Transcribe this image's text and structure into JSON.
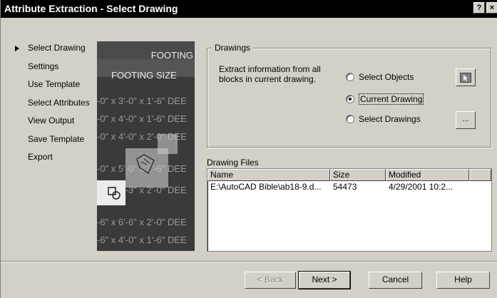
{
  "window": {
    "title": "Attribute Extraction - Select Drawing",
    "help_glyph": "?",
    "close_glyph": "×"
  },
  "steps": [
    {
      "label": "Select Drawing",
      "current": true
    },
    {
      "label": "Settings",
      "current": false
    },
    {
      "label": "Use Template",
      "current": false
    },
    {
      "label": "Select Attributes",
      "current": false
    },
    {
      "label": "View Output",
      "current": false
    },
    {
      "label": "Save Template",
      "current": false
    },
    {
      "label": "Export",
      "current": false
    }
  ],
  "illustration": {
    "header1": "FOOTING",
    "header2": "FOOTING SIZE",
    "rows": [
      "-0\" x 3'-0\" x 1'-6\" DEE",
      "-0\" x 4'-0\" x 1'-6\" DEE",
      "-0\" x 4'-0\" x 2'-0\" DEE",
      "-0\" x 5'-0\" x 1'-6\" DEE",
      "-0\" x 5'-3\" x 2'-0\" DEE",
      "-6\" x 6'-6\" x 2'-0\" DEE",
      "-6\" x 4'-0\" x 1'-6\" DEE"
    ]
  },
  "drawings_group": {
    "label": "Drawings",
    "description": "Extract information from all blocks in current drawing.",
    "options": [
      {
        "label": "Select Objects",
        "selected": false
      },
      {
        "label": "Current Drawing",
        "selected": true
      },
      {
        "label": "Select Drawings",
        "selected": false
      }
    ],
    "pick_button_icon": "pick-objects-icon",
    "browse_button_label": "..."
  },
  "drawing_files": {
    "label": "Drawing Files",
    "columns": [
      "Name",
      "Size",
      "Modified"
    ],
    "rows": [
      {
        "name": "E:\\AutoCAD Bible\\ab18-9.d...",
        "size": "54473",
        "modified": "4/29/2001 10:2..."
      }
    ]
  },
  "buttons": {
    "back": "< Back",
    "next": "Next >",
    "cancel": "Cancel",
    "help": "Help"
  }
}
